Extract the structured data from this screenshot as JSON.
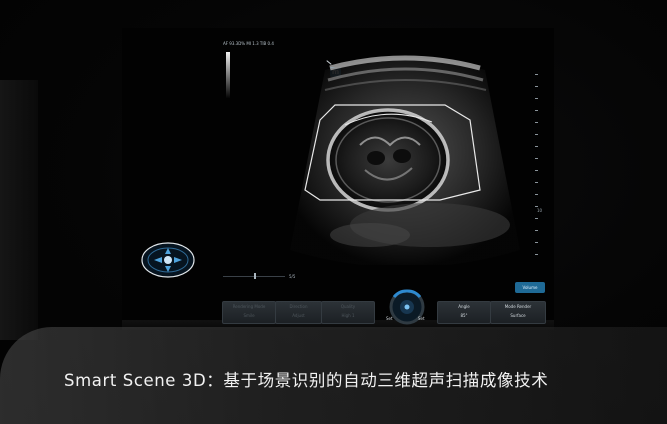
{
  "header": {
    "info_text": "AF 93.3D% MI 1.3 TIB 0.4"
  },
  "image_panel": {
    "mode_icon_label": "m",
    "depth_scale_label": "10"
  },
  "slider": {
    "label": "5/5"
  },
  "freeze_button": {
    "label": "Volume"
  },
  "soft_buttons": [
    {
      "top": "Rendering Mode",
      "bottom": "Smile"
    },
    {
      "top": "Direction",
      "bottom": "Adjust"
    },
    {
      "top": "Quality",
      "bottom": "High 1"
    },
    {
      "top": "Angle",
      "bottom": "85°"
    },
    {
      "top": "Mode Render",
      "bottom": "Surface"
    }
  ],
  "knob": {
    "left_label": "Set",
    "right_label": "Set"
  },
  "caption": {
    "text": "Smart Scene 3D：基于场景识别的自动三维超声扫描成像技术"
  }
}
